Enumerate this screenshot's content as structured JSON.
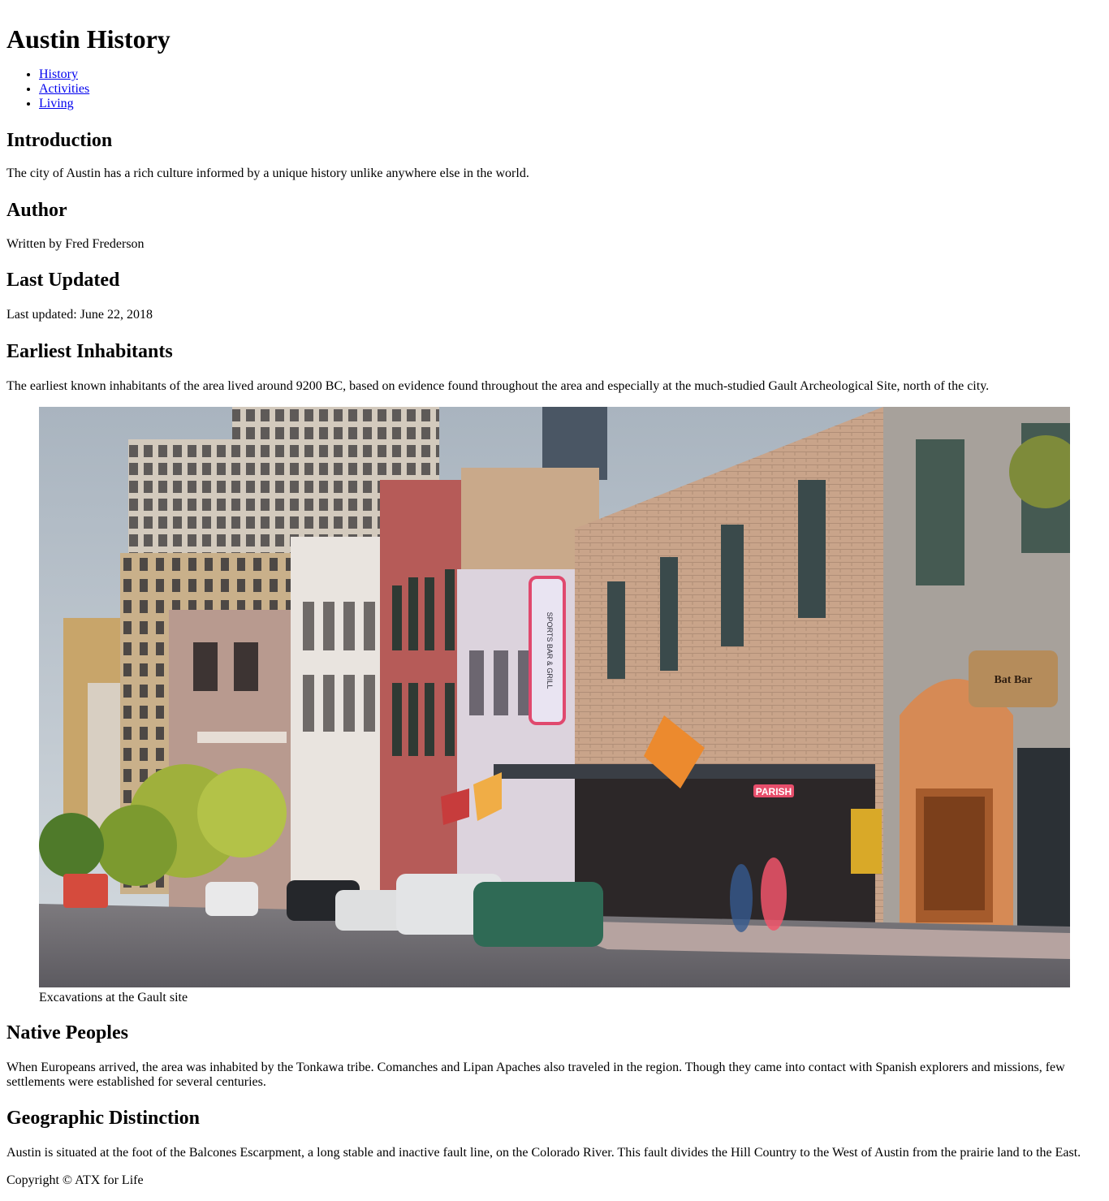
{
  "header": {
    "title": "Austin History"
  },
  "nav": {
    "items": [
      "History",
      "Activities",
      "Living"
    ]
  },
  "sections": [
    {
      "heading": "Introduction",
      "text": "The city of Austin has a rich culture informed by a unique history unlike anywhere else in the world."
    },
    {
      "heading": "Author",
      "text": "Written by Fred Frederson"
    },
    {
      "heading": "Last Updated",
      "text": "Last updated: June 22, 2018"
    },
    {
      "heading": "Earliest Inhabitants",
      "text": "The earliest known inhabitants of the area lived around 9200 BC, based on evidence found throughout the area and especially at the much-studied Gault Archeological Site, north of the city."
    },
    {
      "heading": "Native Peoples",
      "text": "When Europeans arrived, the area was inhabited by the Tonkawa tribe. Comanches and Lipan Apaches also traveled in the region. Though they came into contact with Spanish explorers and missions, few settlements were established for several centuries."
    },
    {
      "heading": "Geographic Distinction",
      "text": "Austin is situated at the foot of the Balcones Escarpment, a long stable and inactive fault line, on the Colorado River. This fault divides the Hill Country to the West of Austin from the prairie land to the East."
    }
  ],
  "figure": {
    "caption": "Excavations at the Gault site",
    "sign_sports_bar": "SPORTS BAR & GRILL",
    "sign_parish": "PARISH",
    "sign_bat_bar": "Bat Bar"
  },
  "footer": {
    "copyright": "Copyright © ATX for Life"
  }
}
